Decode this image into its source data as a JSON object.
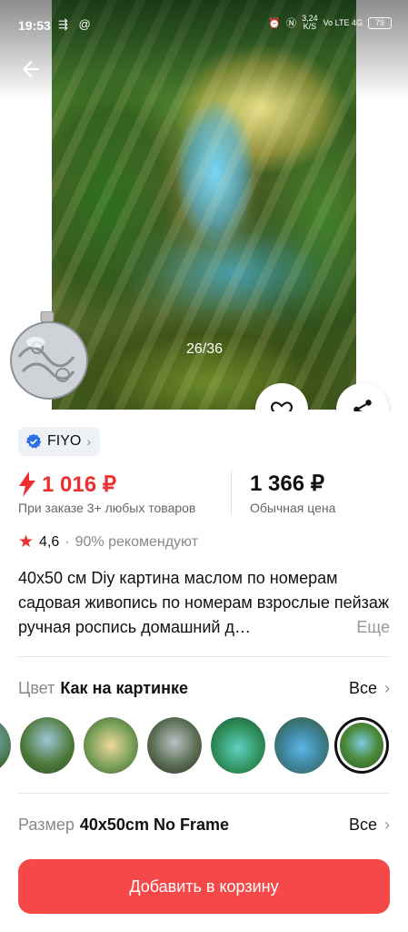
{
  "status_bar": {
    "time": "19:53",
    "left_icons": "⇶ @",
    "net_speed": "3,24\nK/S",
    "network": "Vo LTE 4G",
    "battery": "79"
  },
  "gallery": {
    "counter": "26/36"
  },
  "store": {
    "name": "FIYO"
  },
  "prices": {
    "promo_price": "1 016 ₽",
    "promo_note": "При заказе 3+ любых товаров",
    "regular_price": "1 366 ₽",
    "regular_note": "Обычная цена"
  },
  "rating": {
    "value": "4,6",
    "separator": "·",
    "recommend": "90% рекомендуют"
  },
  "product": {
    "title": "40x50 см Diy картина маслом по номерам садовая живопись по номерам взрослые пейзаж ручная роспись домашний д…",
    "more": "Еще"
  },
  "color_row": {
    "label": "Цвет",
    "value": "Как на картинке",
    "all": "Все"
  },
  "size_row": {
    "label": "Размер",
    "value": "40x50cm No Frame",
    "all": "Все"
  },
  "cart_button": "Добавить в корзину",
  "colors": {
    "accent": "#ee2f2f",
    "cart": "#f54848",
    "verified": "#2d6fe6"
  }
}
